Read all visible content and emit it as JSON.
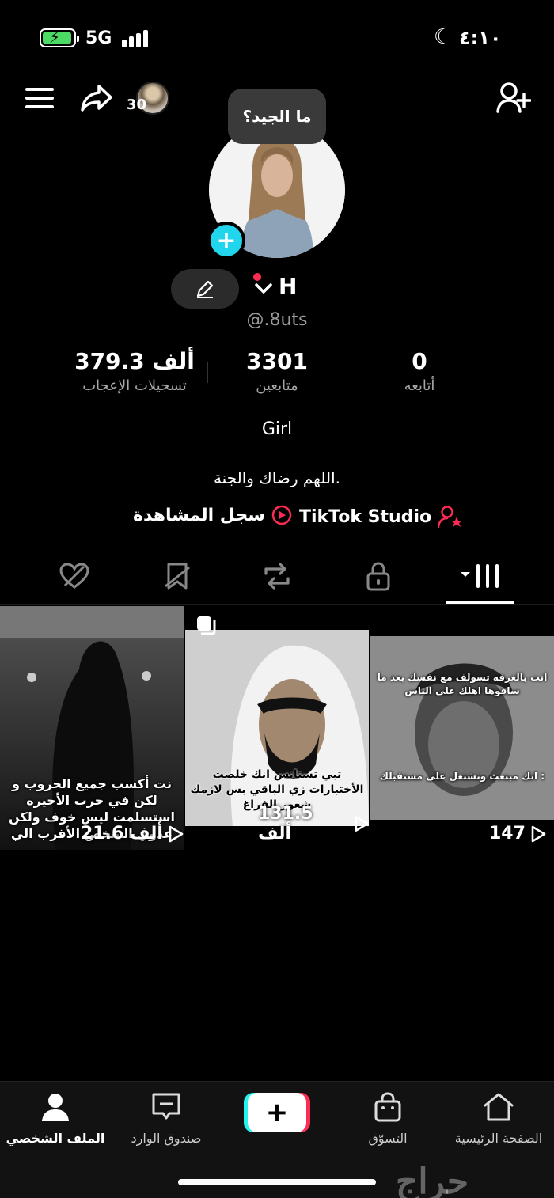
{
  "status_bar": {
    "network": "5G",
    "time": "٤:١٠"
  },
  "header": {
    "friends_count": "30"
  },
  "tooltip": "ما الجيد؟",
  "profile": {
    "name": "H",
    "handle": "@.8uts",
    "stats": [
      {
        "value": "379.3 ألف",
        "label": "تسجيلات الإعجاب"
      },
      {
        "value": "3301",
        "label": "متابعين"
      },
      {
        "value": "0",
        "label": "أتابعه"
      }
    ],
    "bio_title": "Girl",
    "bio": "اللهم رضاك والجنة.",
    "link_studio": "TikTok Studio",
    "link_history": "سجل المشاهدة"
  },
  "videos": [
    {
      "views": "21.6 ألف",
      "caption": "نت أكسب جميع الحروب و لكن في حرب الأخيره استسلمت ليس خوف ولكن عدوي الشخص الأقرب الي"
    },
    {
      "views": "131.5 ألف",
      "caption": "تبي تستانس انك خلصت الأختبارات زي الباقي بس لازمك شعور الفراغ"
    },
    {
      "views": "147",
      "caption_top": "انت بالغرفه تسولف مع نفسك بعد ما سافوها اهلك على الناس",
      "caption": "انك مبتعث وتشتغل على مستقبلك :"
    }
  ],
  "bottom_nav": {
    "profile": "الملف الشخصي",
    "inbox": "صندوق الوارد",
    "create": "+",
    "shop": "التسوّق",
    "home": "الصفحة الرئيسية"
  },
  "watermark": "حراج",
  "colors": {
    "accent_cyan": "#20d5ec",
    "accent_red": "#fe2c55",
    "battery_green": "#4cd964"
  }
}
